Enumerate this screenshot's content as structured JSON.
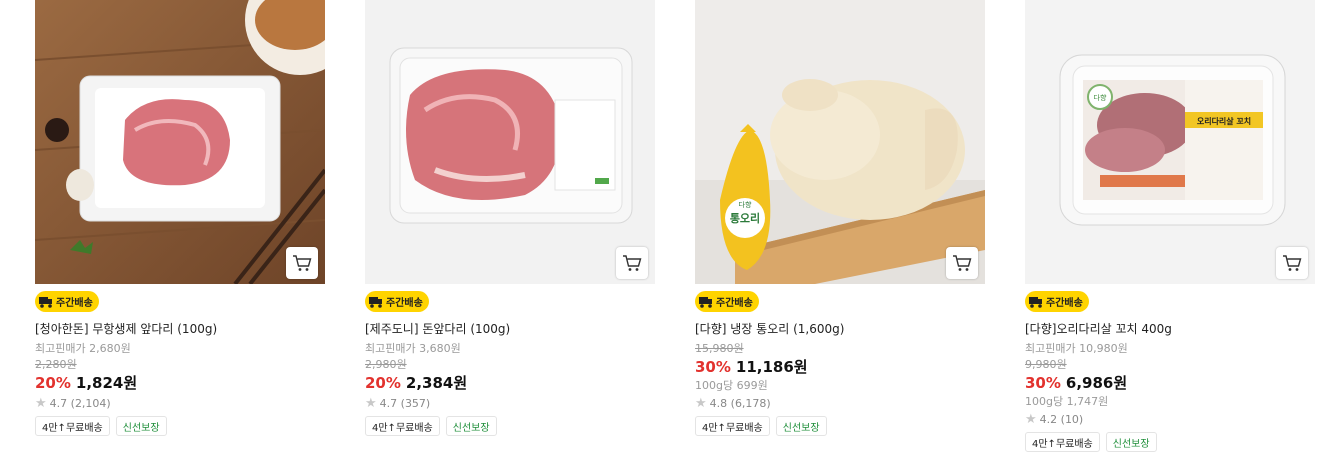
{
  "products": [
    {
      "delivery_badge": "주간배송",
      "title": "[청아한돈] 무항생제 앞다리 (100g)",
      "lowest_price": "최고핀매가 2,680원",
      "original_price": "2,280원",
      "discount_rate": "20%",
      "sale_price": "1,824원",
      "unit_price": "",
      "rating": "4.7 (2,104)",
      "tag_free": "4만↑무료배송",
      "tag_fresh": "신선보장",
      "cart_icon": "cart-icon"
    },
    {
      "delivery_badge": "주간배송",
      "title": "[제주도니] 돈앞다리 (100g)",
      "lowest_price": "최고핀매가 3,680원",
      "original_price": "2,980원",
      "discount_rate": "20%",
      "sale_price": "2,384원",
      "unit_price": "",
      "rating": "4.7 (357)",
      "tag_free": "4만↑무료배송",
      "tag_fresh": "신선보장",
      "cart_icon": "cart-icon"
    },
    {
      "delivery_badge": "주간배송",
      "title": "[다향] 냉장 통오리 (1,600g)",
      "lowest_price": "",
      "original_price": "15,980원",
      "discount_rate": "30%",
      "sale_price": "11,186원",
      "unit_price": "100g당 699원",
      "rating": "4.8 (6,178)",
      "tag_free": "4만↑무료배송",
      "tag_fresh": "신선보장",
      "product_label_1": "통오리",
      "product_label_2": "다향",
      "cart_icon": "cart-icon"
    },
    {
      "delivery_badge": "주간배송",
      "title": "[다향]오리다리살 꼬치 400g",
      "lowest_price": "최고핀매가 10,980원",
      "original_price": "9,980원",
      "discount_rate": "30%",
      "sale_price": "6,986원",
      "unit_price": "100g당 1,747원",
      "rating": "4.2 (10)",
      "tag_free": "4만↑무료배송",
      "tag_fresh": "신선보장",
      "product_label_1": "오리다리살 꼬치",
      "product_label_2": "다향",
      "cart_icon": "cart-icon"
    }
  ],
  "colors": {
    "discount": "#e2322e",
    "badge": "#ffd400",
    "fresh": "#1f8f3a"
  }
}
